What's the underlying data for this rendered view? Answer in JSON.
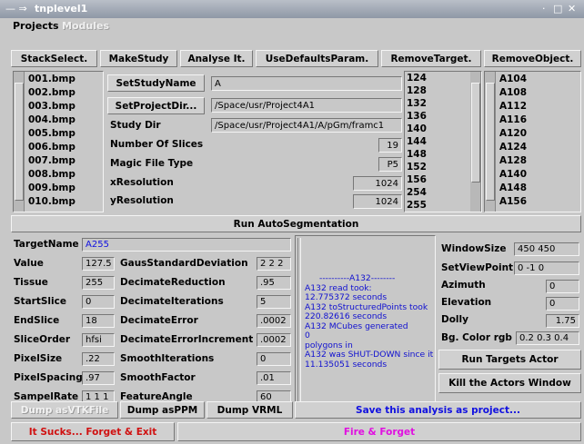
{
  "window": {
    "title": "tnplevel1",
    "minimize": "·",
    "close": "✕"
  },
  "menu": {
    "projects": "Projects",
    "modules": "Modules"
  },
  "toolbar": {
    "stack_select": "StackSelect.",
    "make_study": "MakeStudy",
    "analyse": "Analyse It.",
    "use_defaults": "UseDefaultsParam.",
    "remove_target": "RemoveTarget.",
    "remove_object": "RemoveObject."
  },
  "files": [
    "001.bmp",
    "002.bmp",
    "003.bmp",
    "004.bmp",
    "005.bmp",
    "006.bmp",
    "007.bmp",
    "008.bmp",
    "009.bmp",
    "010.bmp"
  ],
  "study": {
    "set_study_name_label": "SetStudyName",
    "study_name_value": "A",
    "set_project_dir_label": "SetProjectDir...",
    "project_dir_value": "/Space/usr/Project4A1",
    "study_dir_label": "Study Dir",
    "study_dir_value": "/Space/usr/Project4A1/A/pGm/framc1",
    "num_slices_label": "Number Of Slices",
    "num_slices_value": "19",
    "magic_type_label": "Magic File Type",
    "magic_type_value": "P5",
    "xres_label": "xResolution",
    "xres_value": "1024",
    "yres_label": "yResolution",
    "yres_value": "1024"
  },
  "numbers": [
    "124",
    "128",
    "132",
    "136",
    "140",
    "144",
    "148",
    "152",
    "156",
    "254",
    "255"
  ],
  "objects": [
    "A104",
    "A108",
    "A112",
    "A116",
    "A120",
    "A124",
    "A128",
    "A140",
    "A148",
    "A156"
  ],
  "run_autoseg": "Run AutoSegmentation",
  "params": {
    "target_name_label": "TargetName",
    "target_name_value": "A255",
    "value_label": "Value",
    "value_value": "127.5",
    "tissue_label": "Tissue",
    "tissue_value": "255",
    "start_slice_label": "StartSlice",
    "start_slice_value": "0",
    "end_slice_label": "EndSlice",
    "end_slice_value": "18",
    "slice_order_label": "SliceOrder",
    "slice_order_value": "hfsi",
    "pixel_size_label": "PixelSize",
    "pixel_size_value": ".22",
    "pixel_spacing_label": "PixelSpacing",
    "pixel_spacing_value": ".97",
    "sampel_rate_label": "SampelRate",
    "sampel_rate_value": "1 1 1",
    "gaus_label": "GausStandardDeviation",
    "gaus_value": "2 2 2",
    "dec_red_label": "DecimateReduction",
    "dec_red_value": ".95",
    "dec_iter_label": "DecimateIterations",
    "dec_iter_value": "5",
    "dec_err_label": "DecimateError",
    "dec_err_value": ".0002",
    "dec_err_inc_label": "DecimateErrorIncrement",
    "dec_err_inc_value": ".0002",
    "smooth_iter_label": "SmoothIterations",
    "smooth_iter_value": "0",
    "smooth_fac_label": "SmoothFactor",
    "smooth_fac_value": ".01",
    "feature_label": "FeatureAngle",
    "feature_value": "60"
  },
  "log": [
    "----------A132--------",
    "A132 read took:",
    "12.775372 seconds",
    "A132 toStructuredPoints took",
    "220.82616 seconds",
    "A132 MCubes generated",
    "0",
    " polygons in",
    "A132 was SHUT-DOWN since it",
    "11.135051 seconds"
  ],
  "view": {
    "window_size_label": "WindowSize",
    "window_size_value": "450 450",
    "view_point_label": "SetViewPoint",
    "view_point_value": "0 -1 0",
    "azimuth_label": "Azimuth",
    "azimuth_value": "0",
    "elevation_label": "Elevation",
    "elevation_value": "0",
    "dolly_label": "Dolly",
    "dolly_value": "1.75",
    "bg_label": "Bg. Color rgb",
    "bg_value": "0.2 0.3 0.4",
    "run_targets": "Run Targets Actor",
    "kill_window": "Kill the Actors Window"
  },
  "bottom": {
    "dump_vtk": "Dump asVTKFile",
    "dump_ppm": "Dump asPPM",
    "dump_vrml": "Dump VRML",
    "save_analysis": "Save this analysis as project...",
    "exit": "It Sucks... Forget & Exit",
    "fire": "Fire & Forget"
  },
  "colors": {
    "exit_text": "#d01010",
    "fire_text": "#e010e0",
    "link_blue": "#1010e0"
  }
}
